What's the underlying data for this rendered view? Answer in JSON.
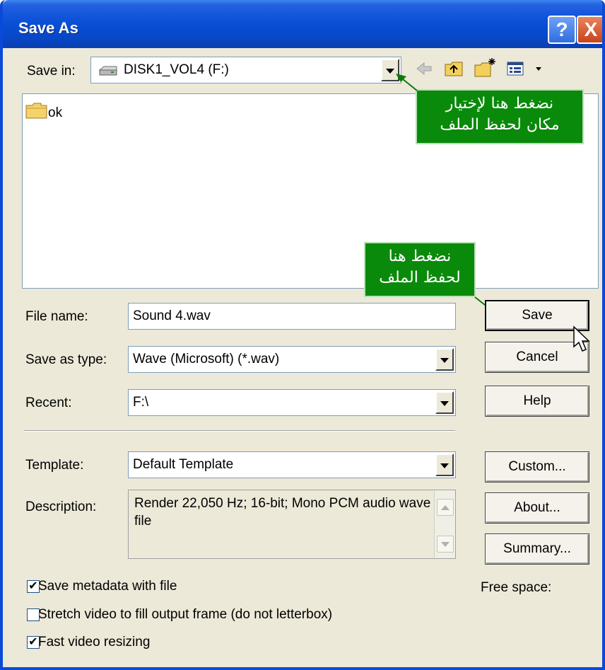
{
  "window": {
    "title": "Save As",
    "help_glyph": "?",
    "close_glyph": "X"
  },
  "save_in": {
    "label": "Save in:",
    "value": "DISK1_VOL4 (F:)",
    "icon": "drive-icon"
  },
  "toolbar": {
    "icons": [
      "back-arrow-icon",
      "up-folder-icon",
      "new-folder-icon",
      "view-menu-icon"
    ]
  },
  "file_list": {
    "items": [
      {
        "name": "ok",
        "icon": "folder-icon"
      }
    ]
  },
  "callouts": {
    "location": [
      "نضغط هنا لإختيار",
      "مكان لحفظ الملف"
    ],
    "save": [
      "نضغط هنا",
      "لحفظ الملف"
    ],
    "color": "#0a8a0a"
  },
  "fields": {
    "file_name_label": "File name:",
    "file_name_value": "Sound 4.wav",
    "save_as_type_label": "Save as type:",
    "save_as_type_value": "Wave (Microsoft) (*.wav)",
    "recent_label": "Recent:",
    "recent_value": "F:\\",
    "template_label": "Template:",
    "template_value": "Default Template",
    "description_label": "Description:",
    "description_value": "Render 22,050 Hz; 16-bit; Mono PCM audio wave file"
  },
  "buttons": {
    "save": "Save",
    "cancel": "Cancel",
    "help": "Help",
    "custom": "Custom...",
    "about": "About...",
    "summary": "Summary..."
  },
  "free_space_label": "Free space:",
  "checkboxes": [
    {
      "label": "Save metadata with file",
      "checked": true
    },
    {
      "label": "Stretch video to fill output frame (do not letterbox)",
      "checked": false
    },
    {
      "label": "Fast video resizing",
      "checked": true
    }
  ],
  "colors": {
    "titlebar": "#0a50d8",
    "dialog_bg": "#ece9d8"
  }
}
